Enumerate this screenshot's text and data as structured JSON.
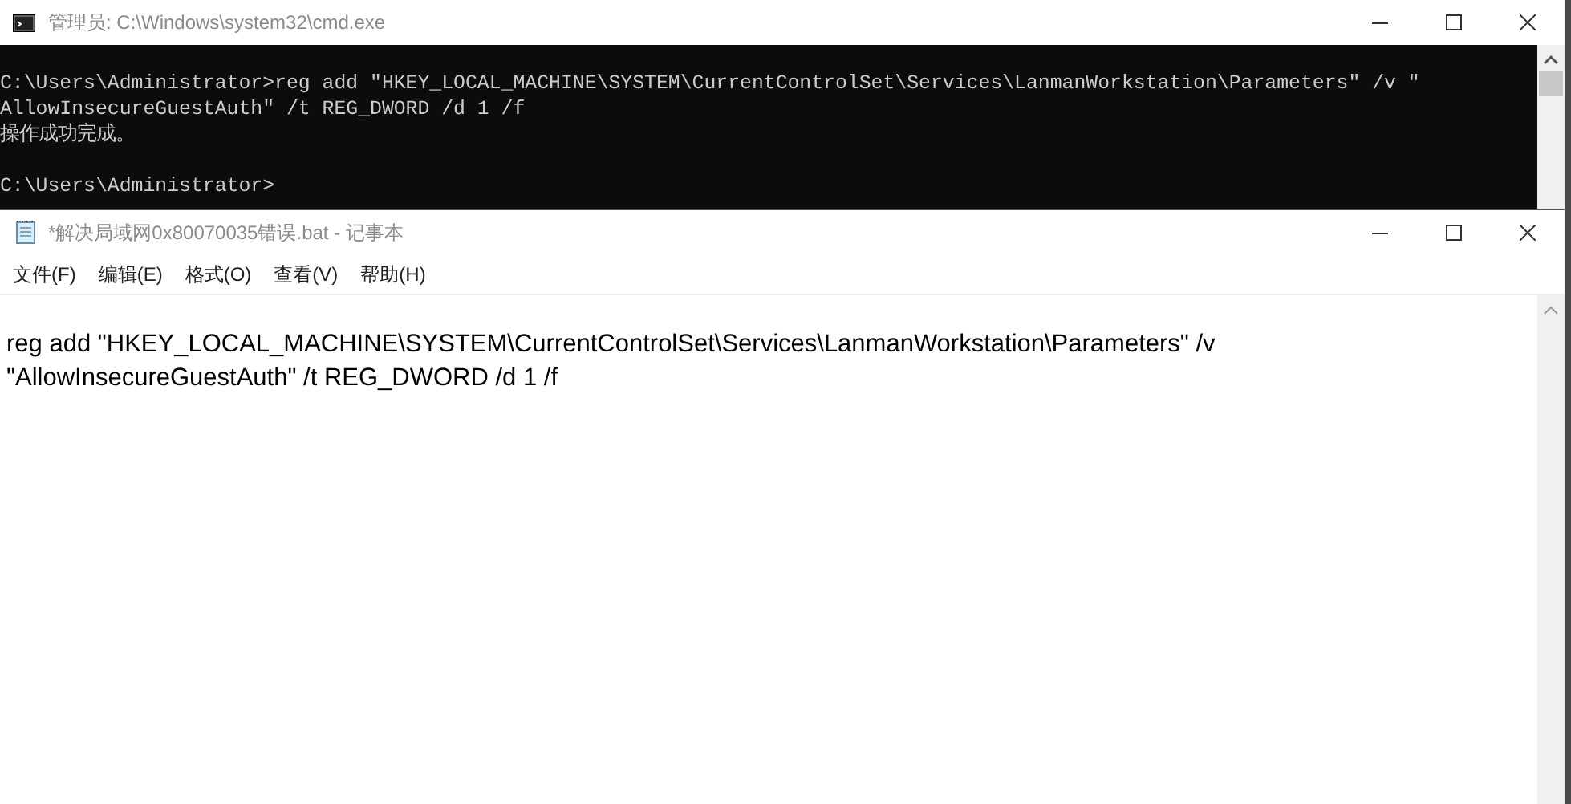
{
  "cmd_window": {
    "title": "管理员: C:\\Windows\\system32\\cmd.exe",
    "console_blocks": [
      [
        "C:\\Users\\Administrator>reg add \"HKEY_LOCAL_MACHINE\\SYSTEM\\CurrentControlSet\\Services\\LanmanWorkstation\\Parameters\" /v \"",
        "AllowInsecureGuestAuth\" /t REG_DWORD /d 1 /f",
        "操作成功完成。"
      ],
      [
        "C:\\Users\\Administrator>"
      ]
    ]
  },
  "notepad_window": {
    "title": "*解决局域网0x80070035错误.bat - 记事本",
    "menu": [
      "文件(F)",
      "编辑(E)",
      "格式(O)",
      "查看(V)",
      "帮助(H)"
    ],
    "text_lines": [
      "reg add \"HKEY_LOCAL_MACHINE\\SYSTEM\\CurrentControlSet\\Services\\LanmanWorkstation\\Parameters\" /v",
      "\"AllowInsecureGuestAuth\" /t REG_DWORD /d 1 /f"
    ]
  }
}
